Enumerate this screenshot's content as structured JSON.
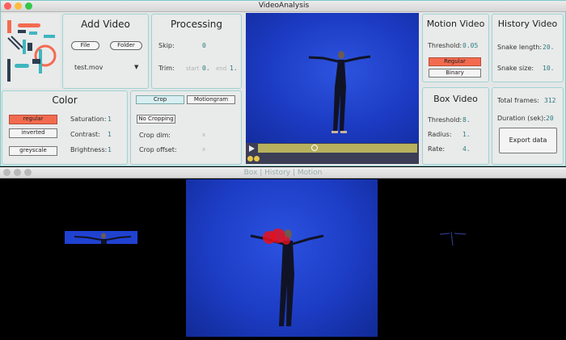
{
  "window": {
    "title": "VideoAnalysis"
  },
  "add_video": {
    "title": "Add Video",
    "file_label": "File",
    "folder_label": "Folder",
    "selected_file": "test.mov"
  },
  "processing": {
    "title": "Processing",
    "skip_label": "Skip:",
    "skip_value": "0",
    "trim_label": "Trim:",
    "trim_start_label": "start",
    "trim_start": "0.",
    "trim_end_label": "end",
    "trim_end": "1."
  },
  "color": {
    "title": "Color",
    "regular_label": "regular",
    "inverted_label": "inverted",
    "greyscale_label": "greyscale",
    "saturation_label": "Saturation:",
    "saturation": "1",
    "contrast_label": "Contrast:",
    "contrast": "1",
    "brightness_label": "Brightness:",
    "brightness": "1",
    "active": "regular",
    "active_color": "#f36b4f"
  },
  "crop": {
    "crop_tab": "Crop",
    "motiongram_tab": "Motiongram",
    "no_cropping_label": "No Cropping",
    "crop_dim_label": "Crop dim:",
    "crop_dim_value": "x",
    "crop_offset_label": "Crop offset:",
    "crop_offset_value": "x"
  },
  "motion_video": {
    "title": "Motion Video",
    "threshold_label": "Threshold:",
    "threshold": "0.05",
    "regular_label": "Regular",
    "binary_label": "Binary"
  },
  "history_video": {
    "title": "History Video",
    "snake_length_label": "Snake length:",
    "snake_length": "20.",
    "snake_size_label": "Snake size:",
    "snake_size": "10."
  },
  "box_video": {
    "title": "Box Video",
    "threshold_label": "Threshold:",
    "threshold": "8.",
    "radius_label": "Radius:",
    "radius": "1.",
    "rate_label": "Rate:",
    "rate": "4."
  },
  "stats": {
    "total_frames_label": "Total frames:",
    "total_frames": "312",
    "duration_label": "Duration (sek):",
    "duration": "20",
    "export_label": "Export data"
  },
  "player": {
    "play_icon": "play-icon",
    "progress": 0.35
  },
  "output_window": {
    "title": "Box | History | Motion"
  },
  "colors": {
    "accent_teal": "#2d7c80",
    "video_blue": "#1c3bc3",
    "scrub": "#b7b15e"
  }
}
